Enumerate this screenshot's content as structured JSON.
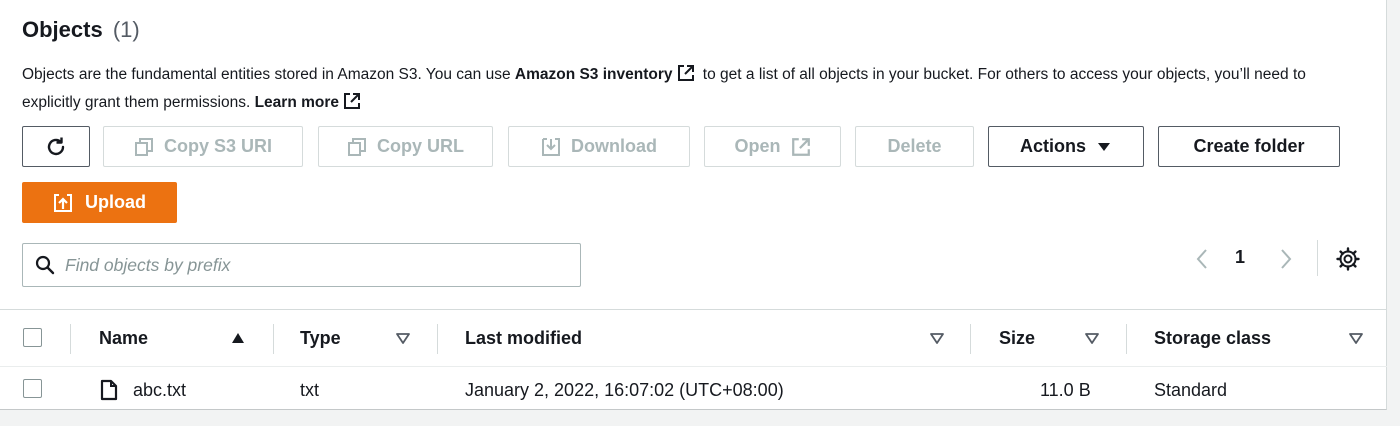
{
  "header": {
    "title": "Objects",
    "count": "(1)"
  },
  "description": {
    "part1": "Objects are the fundamental entities stored in Amazon S3. You can use ",
    "inventory_link": "Amazon S3 inventory",
    "part2": " to get a list of all objects in your bucket. For others to access your objects, you’ll need to explicitly grant them permissions. ",
    "learn_more": "Learn more"
  },
  "toolbar": {
    "copy_s3_uri": "Copy S3 URI",
    "copy_url": "Copy URL",
    "download": "Download",
    "open": "Open",
    "delete": "Delete",
    "actions": "Actions",
    "create_folder": "Create folder",
    "upload": "Upload"
  },
  "search": {
    "placeholder": "Find objects by prefix"
  },
  "pagination": {
    "current_page": "1"
  },
  "table": {
    "columns": [
      "Name",
      "Type",
      "Last modified",
      "Size",
      "Storage class"
    ],
    "rows": [
      {
        "name": "abc.txt",
        "type": "txt",
        "last_modified": "January 2, 2022, 16:07:02 (UTC+08:00)",
        "size": "11.0 B",
        "storage_class": "Standard"
      }
    ]
  },
  "colors": {
    "upload_orange": "#ec7211",
    "disabled_text": "#aab7b8",
    "border": "#545b64"
  }
}
